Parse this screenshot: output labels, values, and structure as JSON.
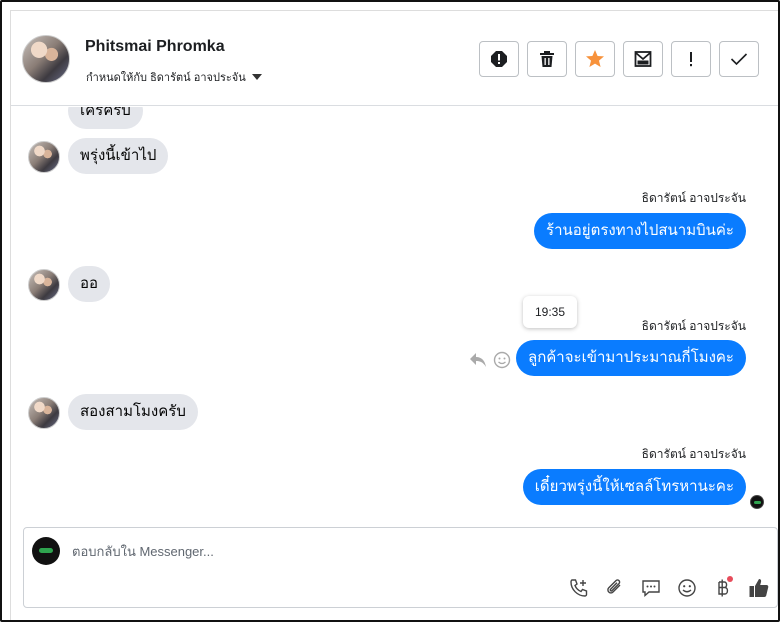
{
  "header": {
    "contact_name": "Phitsmai Phromka",
    "assigned_to": "กำหนดให้กับ ธิดารัตน์ อาจประจัน"
  },
  "toolbar": [
    {
      "name": "spam-button",
      "icon": "alert-octagon-icon"
    },
    {
      "name": "delete-button",
      "icon": "trash-icon"
    },
    {
      "name": "star-button",
      "icon": "star-icon",
      "color": "#f7923b"
    },
    {
      "name": "mark-unread-button",
      "icon": "envelope-icon"
    },
    {
      "name": "follow-up-button",
      "icon": "exclamation-icon"
    },
    {
      "name": "done-button",
      "icon": "check-icon"
    }
  ],
  "messages": {
    "m1": "เครครับ",
    "m2": "พรุ่งนี้เข้าไป",
    "m3_sender": "ธิดารัตน์ อาจประจัน",
    "m3": "ร้านอยู่ตรงทางไปสนามบินค่ะ",
    "m4": "ออ",
    "m5_tooltip": "19:35",
    "m5_sender": "ธิดารัตน์ อาจประจัน",
    "m5": "ลูกค้าจะเข้ามาประมาณกี่โมงคะ",
    "m6": "สองสามโมงครับ",
    "m7_sender": "ธิดารัตน์ อาจประจัน",
    "m7": "เดี๋ยวพรุ่งนี้ให้เซลล์โทรหานะคะ"
  },
  "composer": {
    "placeholder": "ตอบกลับใน Messenger...",
    "value": ""
  },
  "colors": {
    "outgoing_bubble": "#0a7cff",
    "incoming_bubble": "#e4e6eb",
    "star": "#f7923b",
    "notification_dot": "#e74c5b"
  }
}
